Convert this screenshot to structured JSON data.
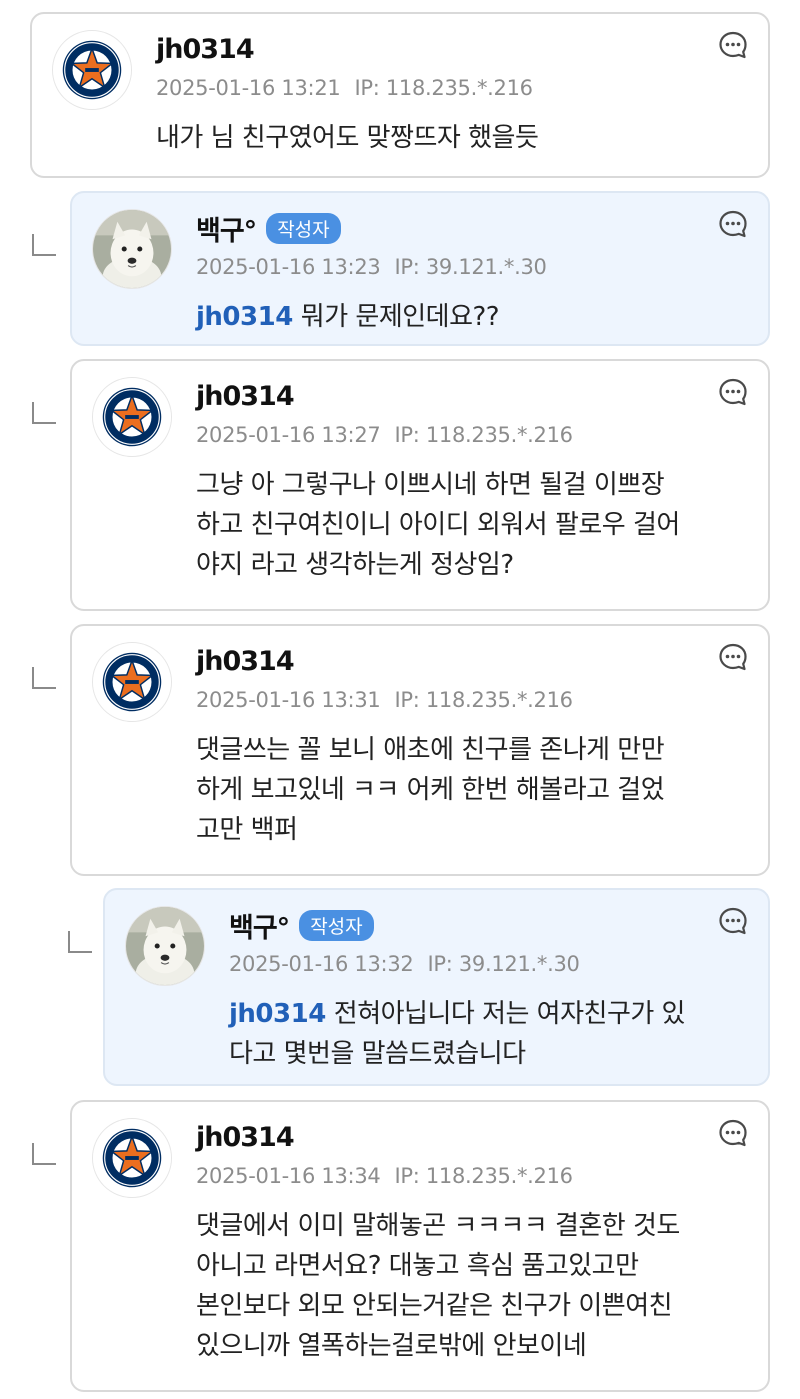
{
  "comments": [
    {
      "nickname": "jh0314",
      "badge": "",
      "date": "2025-01-16 13:21",
      "ip": "IP: 118.235.*.216",
      "mention": "",
      "lines": [
        "내가 님 친구였어도 맞짱뜨자 했을듯"
      ],
      "avatar": "astros-logo-icon"
    },
    {
      "nickname": "백구°",
      "badge": "작성자",
      "date": "2025-01-16 13:23",
      "ip": "IP: 39.121.*.30",
      "mention": "jh0314",
      "lines": [
        "뭐가 문제인데요??"
      ],
      "avatar": "white-dog-avatar"
    },
    {
      "nickname": "jh0314",
      "badge": "",
      "date": "2025-01-16 13:27",
      "ip": "IP: 118.235.*.216",
      "mention": "",
      "lines": [
        "그냥 아 그렇구나 이쁘시네 하면 될걸 이쁘장",
        "하고 친구여친이니 아이디 외워서 팔로우 걸어",
        "야지 라고 생각하는게 정상임?"
      ],
      "avatar": "astros-logo-icon"
    },
    {
      "nickname": "jh0314",
      "badge": "",
      "date": "2025-01-16 13:31",
      "ip": "IP: 118.235.*.216",
      "mention": "",
      "lines": [
        "댓글쓰는 꼴 보니 애초에 친구를 존나게 만만",
        "하게 보고있네 ㅋㅋ 어케 한번 해볼라고 걸었",
        "고만 백퍼"
      ],
      "avatar": "astros-logo-icon"
    },
    {
      "nickname": "백구°",
      "badge": "작성자",
      "date": "2025-01-16 13:32",
      "ip": "IP: 39.121.*.30",
      "mention": "jh0314",
      "lines": [
        "전혀아닙니다 저는 여자친구가 있",
        "다고 몇번을 말씀드렸습니다"
      ],
      "avatar": "white-dog-avatar"
    },
    {
      "nickname": "jh0314",
      "badge": "",
      "date": "2025-01-16 13:34",
      "ip": "IP: 118.235.*.216",
      "mention": "",
      "lines": [
        "댓글에서 이미 말해놓곤 ㅋㅋㅋㅋ 결혼한 것도",
        "아니고 라면서요? 대놓고 흑심 품고있고만",
        "본인보다 외모 안되는거같은 친구가 이쁜여친",
        "있으니까 열폭하는걸로밖에 안보이네"
      ],
      "avatar": "astros-logo-icon"
    }
  ],
  "colors": {
    "op_background": "#eef5fe",
    "badge": "#4a90e2",
    "mention": "#2160b8",
    "astros_navy": "#002d62",
    "astros_orange": "#eb6e1f"
  },
  "icons": {
    "comment_menu": "speech-bubble-dots-icon",
    "reply": "reply-elbow-icon"
  }
}
